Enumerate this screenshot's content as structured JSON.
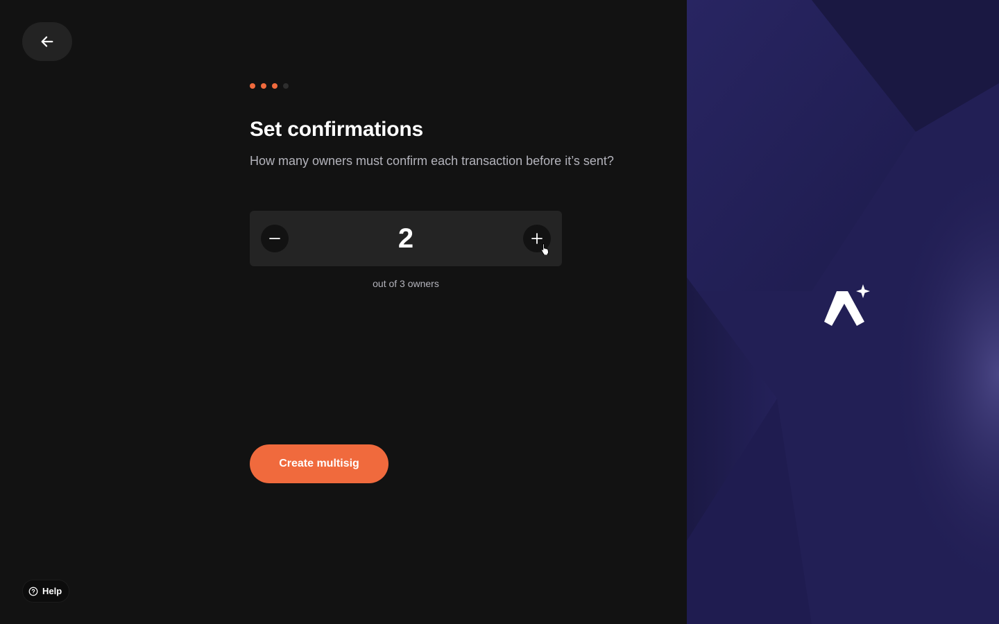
{
  "progress": {
    "total_steps": 4,
    "completed_steps": 3,
    "active_color": "#f06a3d",
    "inactive_color": "#2e2e2e"
  },
  "back": {
    "icon": "arrow-left-icon"
  },
  "header": {
    "title": "Set confirmations",
    "subtitle": "How many owners must confirm each transaction before it’s sent?"
  },
  "stepper": {
    "value": "2",
    "decrement_icon": "minus-icon",
    "increment_icon": "plus-icon"
  },
  "owners_caption": "out of 3 owners",
  "actions": {
    "create_label": "Create multisig"
  },
  "help": {
    "label": "Help",
    "icon": "question-circle-icon"
  },
  "brand": {
    "icon": "sparkle-logo-icon",
    "panel_color": "#221f55"
  }
}
